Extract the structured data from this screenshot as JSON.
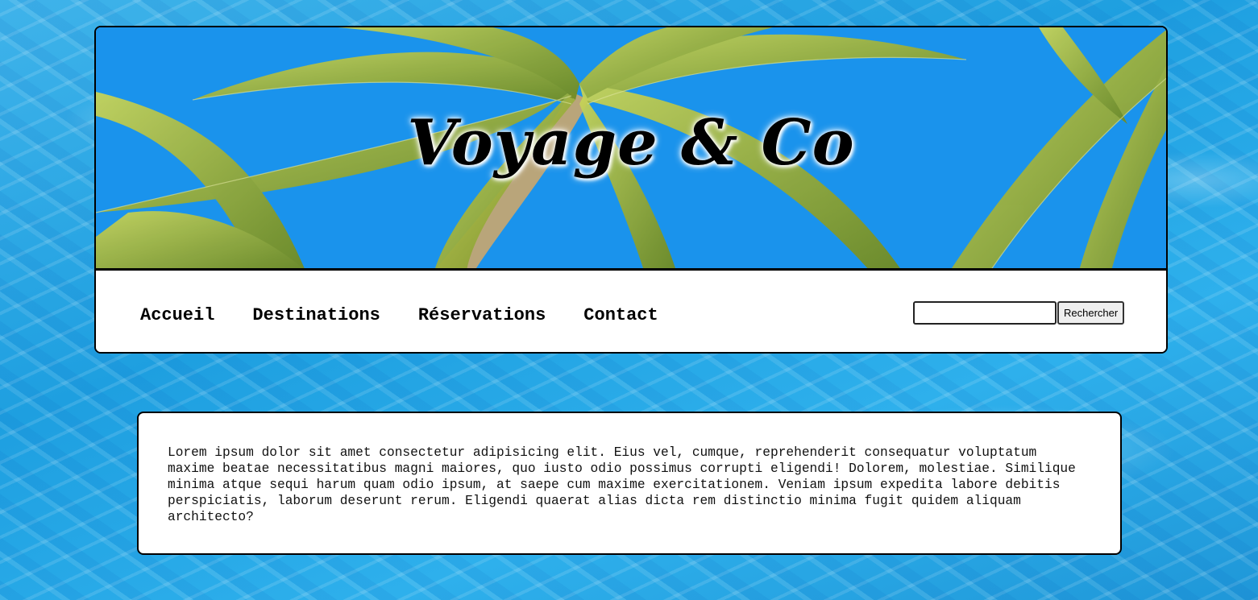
{
  "header": {
    "site_title": "Voyage & Co"
  },
  "nav": {
    "items": [
      {
        "label": "Accueil"
      },
      {
        "label": "Destinations"
      },
      {
        "label": "Réservations"
      },
      {
        "label": "Contact"
      }
    ]
  },
  "search": {
    "value": "",
    "placeholder": "",
    "button_label": "Rechercher"
  },
  "main": {
    "paragraph": "Lorem ipsum dolor sit amet consectetur adipisicing elit. Eius vel, cumque, reprehenderit consequatur voluptatum maxime beatae necessitatibus magni maiores, quo iusto odio possimus corrupti eligendi! Dolorem, molestiae. Similique minima atque sequi harum quam odio ipsum, at saepe cum maxime exercitationem. Veniam ipsum expedita labore debitis perspiciatis, laborum deserunt rerum. Eligendi quaerat alias dicta rem distinctio minima fugit quidem aliquam architecto?"
  },
  "colors": {
    "sky": "#1a93ec",
    "palm_frond": "#9bb83a",
    "water": "#2aa8e8"
  }
}
